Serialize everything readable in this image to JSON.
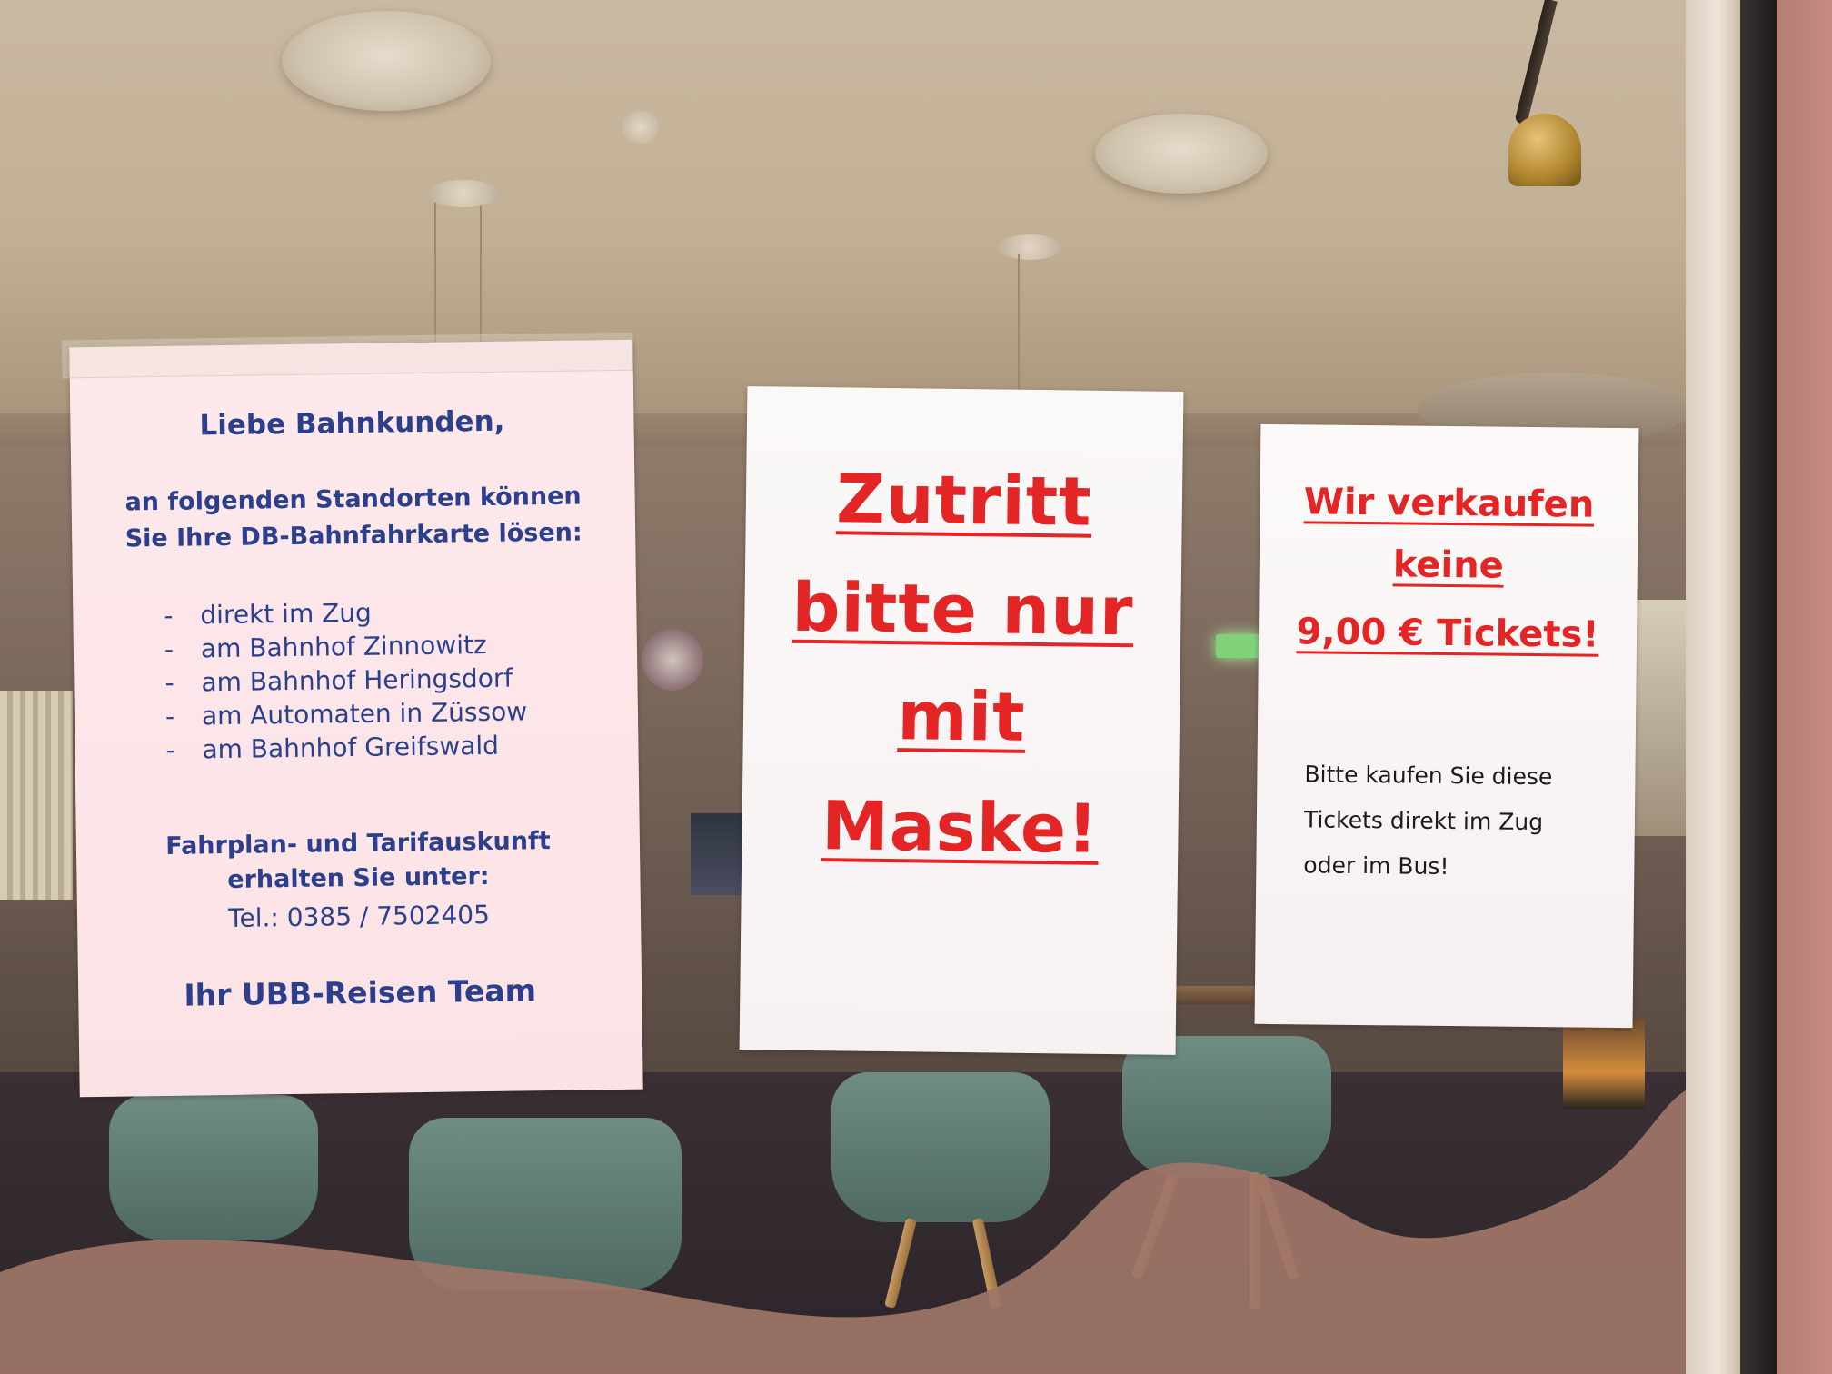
{
  "sign_left": {
    "title": "Liebe Bahnkunden,",
    "intro_line1": "an folgenden Standorten können",
    "intro_line2": "Sie Ihre DB-Bahnfahrkarte lösen:",
    "locations": [
      "direkt im Zug",
      "am Bahnhof Zinnowitz",
      "am Bahnhof Heringsdorf",
      "am Automaten in Züssow",
      "am Bahnhof Greifswald"
    ],
    "dash": "-",
    "info_line1": "Fahrplan- und Tarifauskunft",
    "info_line2": "erhalten Sie unter:",
    "phone": "Tel.: 0385 / 7502405",
    "sign_off": "Ihr UBB-Reisen Team"
  },
  "sign_middle": {
    "line1": "Zutritt",
    "line2": "bitte nur",
    "line3": "mit",
    "line4": "Maske!"
  },
  "sign_right": {
    "line1": "Wir verkaufen",
    "line2": "keine",
    "line3": "9,00 € Tickets!",
    "body_line1": "Bitte kaufen Sie diese",
    "body_line2": "Tickets direkt im Zug",
    "body_line3": "oder im Bus!"
  },
  "colors": {
    "blue_text": "#2b3f8c",
    "red_text": "#e32526",
    "dark_text": "#1d1a1a"
  }
}
